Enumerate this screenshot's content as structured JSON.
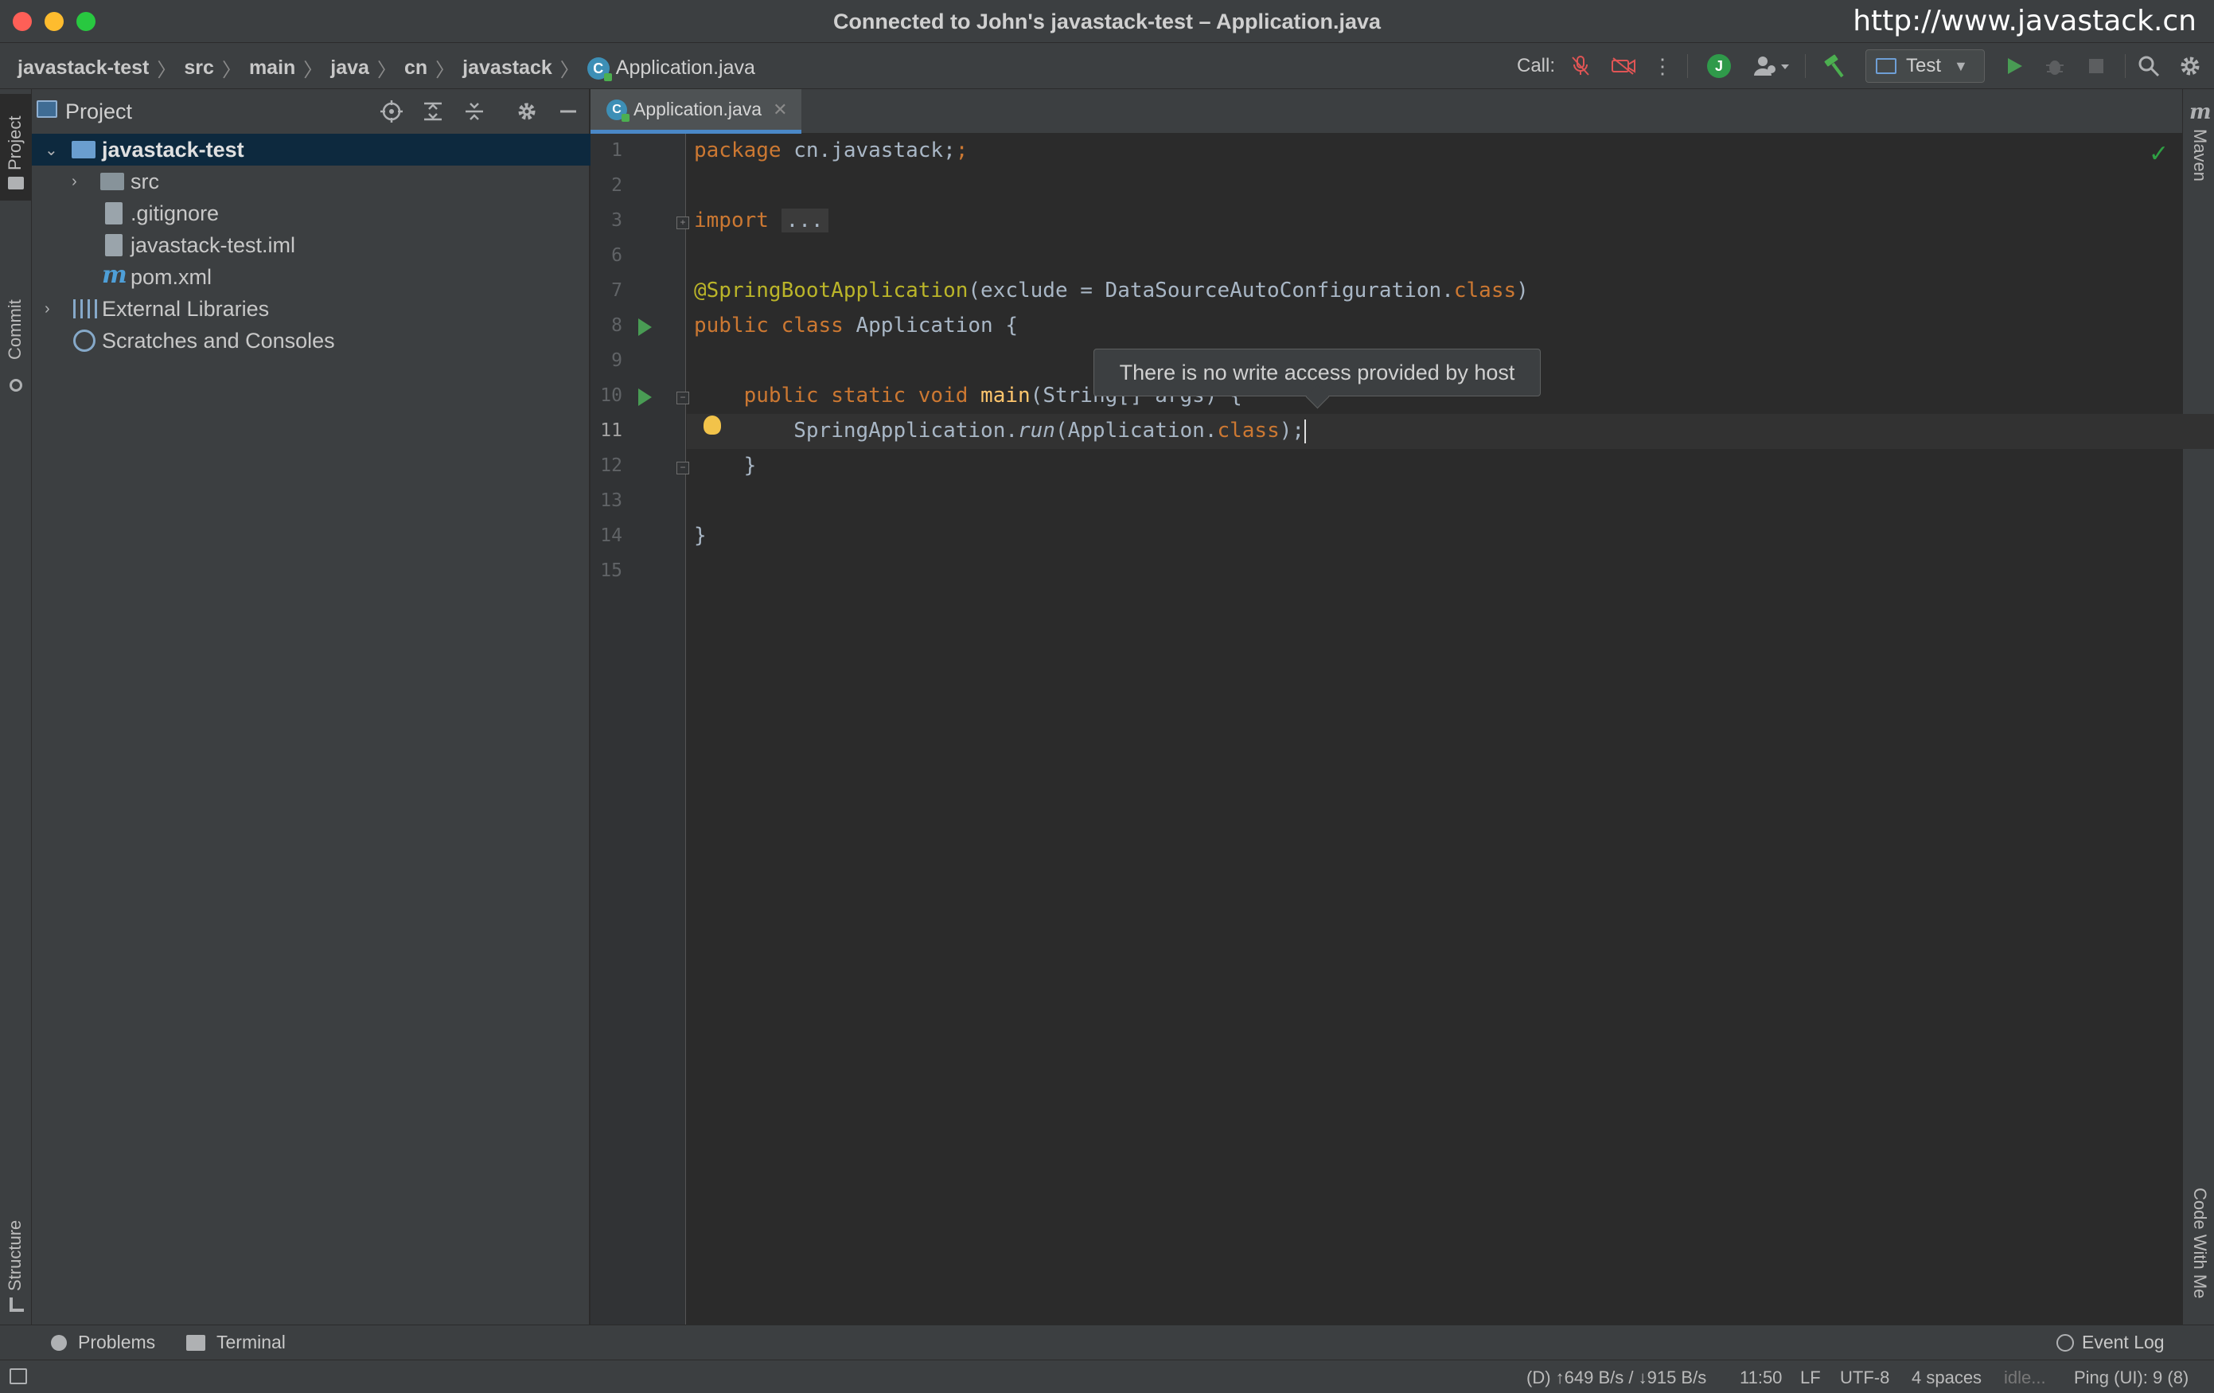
{
  "window": {
    "title": "Connected to John's javastack-test – Application.java",
    "watermark": "http://www.javastack.cn"
  },
  "breadcrumbs": [
    "javastack-test",
    "src",
    "main",
    "java",
    "cn",
    "javastack",
    "Application.java"
  ],
  "toolbar": {
    "call_label": "Call:",
    "avatar_letter": "J",
    "run_config": "Test",
    "icons": [
      "mic-muted-icon",
      "camera-off-icon",
      "more-vertical-icon",
      "avatar-icon",
      "user-permissions-icon",
      "build-hammer-icon",
      "run-icon",
      "debug-icon",
      "stop-icon",
      "search-icon",
      "settings-icon"
    ]
  },
  "left_strip": {
    "project": "Project",
    "commit": "Commit",
    "structure": "Structure"
  },
  "right_strip": {
    "maven": "Maven",
    "code_with_me": "Code With Me"
  },
  "project_panel": {
    "title": "Project",
    "tree": [
      {
        "label": "javastack-test",
        "type": "module",
        "selected": true
      },
      {
        "label": "src",
        "type": "folder"
      },
      {
        "label": ".gitignore",
        "type": "file"
      },
      {
        "label": "javastack-test.iml",
        "type": "file"
      },
      {
        "label": "pom.xml",
        "type": "maven"
      },
      {
        "label": "External Libraries",
        "type": "library"
      },
      {
        "label": "Scratches and Consoles",
        "type": "scratches"
      }
    ]
  },
  "editor": {
    "tab_label": "Application.java",
    "line_numbers": [
      "1",
      "2",
      "3",
      "6",
      "7",
      "8",
      "9",
      "10",
      "11",
      "12",
      "13",
      "14",
      "15"
    ],
    "current_line": "11",
    "code": {
      "l1_kw": "package",
      "l1_rest": " cn.javastack;",
      "l3_kw": "import",
      "l3_fold": "...",
      "l7_ann": "@SpringBootApplication",
      "l7_mid": "(exclude = DataSourceAutoConfiguration.",
      "l7_kw": "class",
      "l7_end": ")",
      "l8_kw": "public class",
      "l8_rest": " Application {",
      "l10_kw": "public static void",
      "l10_meth": "main",
      "l10_rest": "(String[] args) {",
      "l11_a": "SpringApplication.",
      "l11_run": "run",
      "l11_b": "(Application.",
      "l11_kw": "class",
      "l11_end": ");",
      "l12": "}",
      "l14": "}"
    },
    "tooltip": "There is no write access provided by host"
  },
  "bottom_tools": {
    "problems": "Problems",
    "terminal": "Terminal",
    "event_log": "Event Log"
  },
  "status": {
    "transfer": "(D) ↑649 B/s / ↓915 B/s",
    "position": "11:50",
    "line_sep": "LF",
    "encoding": "UTF-8",
    "indent": "4 spaces",
    "state": "idle...",
    "ping": "Ping (UI): 9 (8)"
  },
  "colors": {
    "background": "#2b2b2b",
    "panel": "#3c3f41",
    "keyword": "#cc7832",
    "annotation": "#bbb529",
    "method": "#ffc66d",
    "accent": "#4a88c7",
    "run_green": "#499c54"
  }
}
